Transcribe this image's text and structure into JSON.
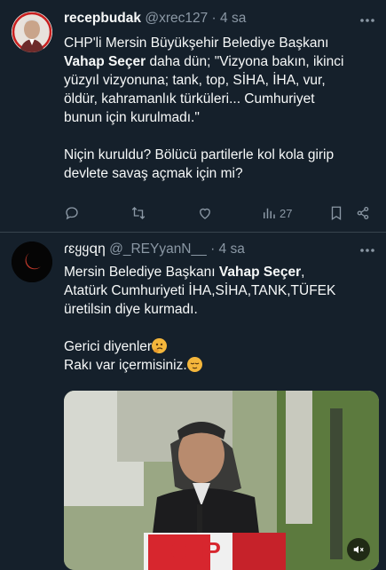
{
  "tweets": [
    {
      "name": "recepbudak",
      "handle": "@xrec127",
      "separator": "·",
      "time": "4 sa",
      "lines": [
        "CHP'li Mersin Büyükşehir Belediye Başkanı",
        "daha dün; \"Vizyona bakın, ikinci",
        "yüzyıl vizyonuna; tank, top, SİHA, İHA, vur,",
        "öldür, kahramanlık türküleri... Cumhuriyet",
        "bunun için kurulmadı.\"",
        "Niçin kuruldu? Bölücü partilerle kol kola girip",
        "devlete savaş açmak için mi?"
      ],
      "bold_name": "Vahap Seçer",
      "views": "27"
    },
    {
      "name": "ɾɛყყզη",
      "handle": "@_REYyanN__",
      "separator": "·",
      "time": "4 sa",
      "line1_pre": "Mersin Belediye Başkanı",
      "bold_name": "Vahap Seçer",
      "line1_post": ",",
      "lines": [
        "Atatürk Cumhuriyeti İHA,SİHA,TANK,TÜFEK",
        "üretilsin diye kurmadı.",
        "Gerici diyenler",
        "Rakı var içermisiniz."
      ],
      "video_podium_text": "CHP"
    }
  ],
  "icons": [
    "reply-icon",
    "retweet-icon",
    "like-icon",
    "views-icon",
    "bookmark-icon",
    "share-icon",
    "mute-icon",
    "thinking-emoji",
    "relieved-emoji"
  ],
  "colors": {
    "background": "#15202b",
    "text": "#f7f9f9",
    "muted": "#8b98a5",
    "divider": "#38444d"
  }
}
